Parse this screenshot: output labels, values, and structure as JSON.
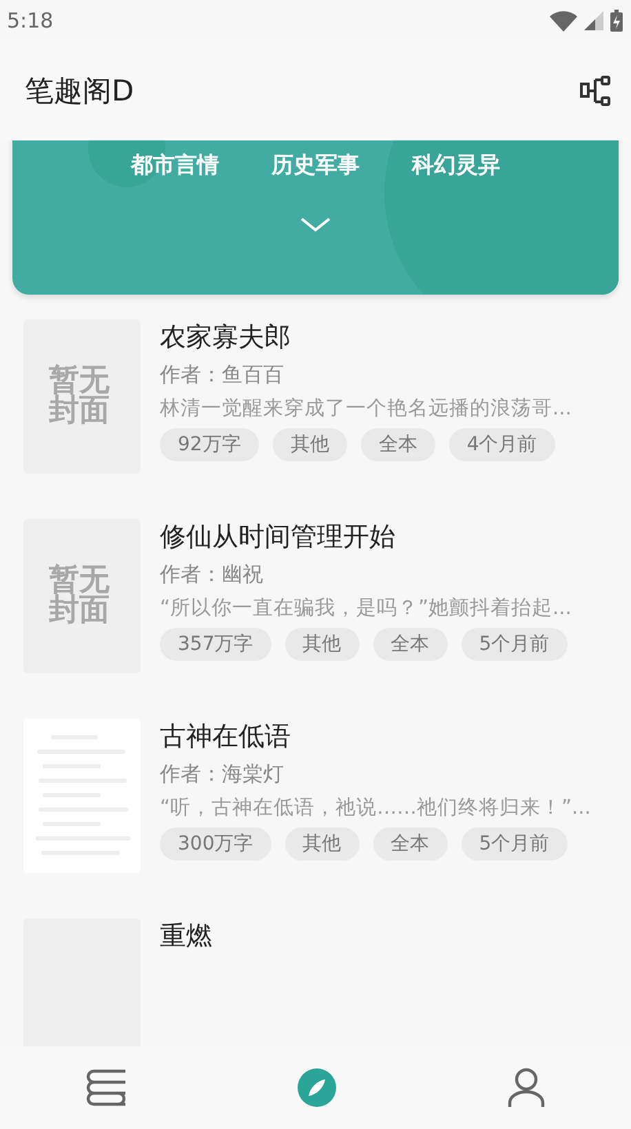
{
  "status_bar": {
    "time": "5:18"
  },
  "header": {
    "title": "笔趣阁D"
  },
  "banner": {
    "categories": [
      "都市言情",
      "历史军事",
      "科幻灵异"
    ],
    "expanded": false
  },
  "books": [
    {
      "title": "农家寡夫郎",
      "author": "作者：鱼百百",
      "description": "林清一觉醒来穿成了一个艳名远播的浪荡哥...",
      "tags": [
        "92万字",
        "其他",
        "全本",
        "4个月前"
      ],
      "cover": {
        "kind": "placeholder",
        "text": "暂无封面"
      }
    },
    {
      "title": "修仙从时间管理开始",
      "author": "作者：幽祝",
      "description": "“所以你一直在骗我，是吗？”她颤抖着抬起...",
      "tags": [
        "357万字",
        "其他",
        "全本",
        "5个月前"
      ],
      "cover": {
        "kind": "placeholder",
        "text": "暂无封面"
      }
    },
    {
      "title": "古神在低语",
      "author": "作者：海棠灯",
      "description": "“听，古神在低语，祂说……祂们终将归来！”...",
      "tags": [
        "300万字",
        "其他",
        "全本",
        "5个月前"
      ],
      "cover": {
        "kind": "lines"
      }
    },
    {
      "title": "重燃",
      "cover": {
        "kind": "blank"
      }
    }
  ],
  "bottom_nav": [
    {
      "kind": "shelf",
      "selected": false
    },
    {
      "kind": "discover",
      "selected": true
    },
    {
      "kind": "profile",
      "selected": false
    }
  ]
}
